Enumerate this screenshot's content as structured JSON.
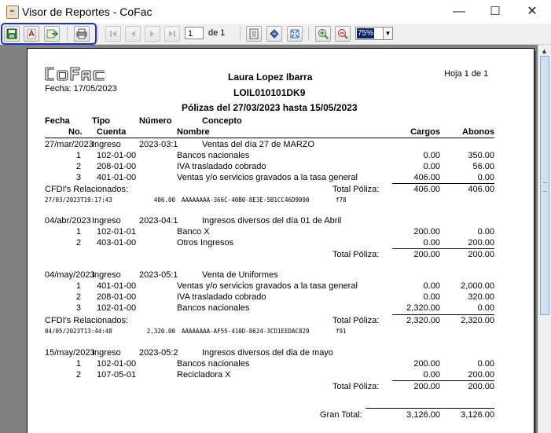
{
  "window": {
    "title": "Visor de Reportes - CoFac",
    "minimize": "—",
    "maximize": "☐",
    "close": "✕"
  },
  "toolbar": {
    "page_number": "1",
    "page_of": "de 1",
    "zoom": "75%"
  },
  "report": {
    "logo": "CoFac",
    "fecha": "Fecha: 17/05/2023",
    "company_name": "Laura Lopez Ibarra",
    "rfc": "LOIL010101DK9",
    "title": "Pólizas del 27/03/2023 hasta 15/05/2023",
    "page_label": "Hoja 1 de 1",
    "headers": {
      "fecha": "Fecha",
      "tipo": "Tipo",
      "numero": "Número",
      "concepto": "Concepto",
      "no": "No.",
      "cuenta": "Cuenta",
      "nombre": "Nombre",
      "cargos": "Cargos",
      "abonos": "Abonos"
    },
    "polizas": [
      {
        "fecha": "27/mar/2023",
        "tipo": "Ingreso",
        "numero": "2023-03:1",
        "concepto": "Ventas del día 27 de MARZO",
        "rows": [
          {
            "no": "1",
            "cuenta": "102-01-00",
            "nombre": "Bancos nacionales",
            "cargos": "0.00",
            "abonos": "350.00"
          },
          {
            "no": "2",
            "cuenta": "208-01-00",
            "nombre": "IVA trasladado cobrado",
            "cargos": "0.00",
            "abonos": "56.00"
          },
          {
            "no": "3",
            "cuenta": "401-01-00",
            "nombre": "Ventas y/o servicios gravados a la tasa general",
            "cargos": "406.00",
            "abonos": "0.00"
          }
        ],
        "cfdi_label": "CFDI's Relacionados:",
        "total_label": "Total Póliza:",
        "total_cargos": "406.00",
        "total_abonos": "406.00",
        "cfdi": {
          "date": "27/03/2023T19:17:43",
          "amount": "406.00",
          "uuid": "AAAAAAAA-366C-40B0-8E3E-5B1CC46D9090",
          "folio": "f78"
        }
      },
      {
        "fecha": "04/abr/2023",
        "tipo": "Ingreso",
        "numero": "2023-04:1",
        "concepto": "Ingresos diversos del día 01 de Abril",
        "rows": [
          {
            "no": "1",
            "cuenta": "102-01-01",
            "nombre": "Banco X",
            "cargos": "200.00",
            "abonos": "0.00"
          },
          {
            "no": "2",
            "cuenta": "403-01-00",
            "nombre": "Otros Ingresos",
            "cargos": "0.00",
            "abonos": "200.00"
          }
        ],
        "total_label": "Total Póliza:",
        "total_cargos": "200.00",
        "total_abonos": "200.00"
      },
      {
        "fecha": "04/may/2023",
        "tipo": "Ingreso",
        "numero": "2023-05:1",
        "concepto": "Venta de Uniformes",
        "rows": [
          {
            "no": "1",
            "cuenta": "401-01-00",
            "nombre": "Ventas y/o servicios gravados a la tasa general",
            "cargos": "0.00",
            "abonos": "2,000.00"
          },
          {
            "no": "2",
            "cuenta": "208-01-00",
            "nombre": "IVA trasladado cobrado",
            "cargos": "0.00",
            "abonos": "320.00"
          },
          {
            "no": "3",
            "cuenta": "102-01-00",
            "nombre": "Bancos nacionales",
            "cargos": "2,320.00",
            "abonos": "0.00"
          }
        ],
        "cfdi_label": "CFDI's Relacionados:",
        "total_label": "Total Póliza:",
        "total_cargos": "2,320.00",
        "total_abonos": "2,320.00",
        "cfdi": {
          "date": "04/05/2023T13:44:48",
          "amount": "2,320.00",
          "uuid": "AAAAAAAA-AF55-410D-8624-3CD1EEDAC829",
          "folio": "f91"
        }
      },
      {
        "fecha": "15/may/2023",
        "tipo": "Ingreso",
        "numero": "2023-05:2",
        "concepto": "Ingresos diversos del dia  de mayo",
        "rows": [
          {
            "no": "1",
            "cuenta": "102-01-00",
            "nombre": "Bancos nacionales",
            "cargos": "200.00",
            "abonos": "0.00"
          },
          {
            "no": "2",
            "cuenta": "107-05-01",
            "nombre": "Recicladora X",
            "cargos": "0.00",
            "abonos": "200.00"
          }
        ],
        "total_label": "Total Póliza:",
        "total_cargos": "200.00",
        "total_abonos": "200.00"
      }
    ],
    "gran_total_label": "Gran Total:",
    "gran_total_cargos": "3,126.00",
    "gran_total_abonos": "3,126.00"
  },
  "colors": {
    "highlight_border": "#1a2fc7",
    "viewport_bg": "#808080",
    "zoom_selection": "#0a246a"
  }
}
